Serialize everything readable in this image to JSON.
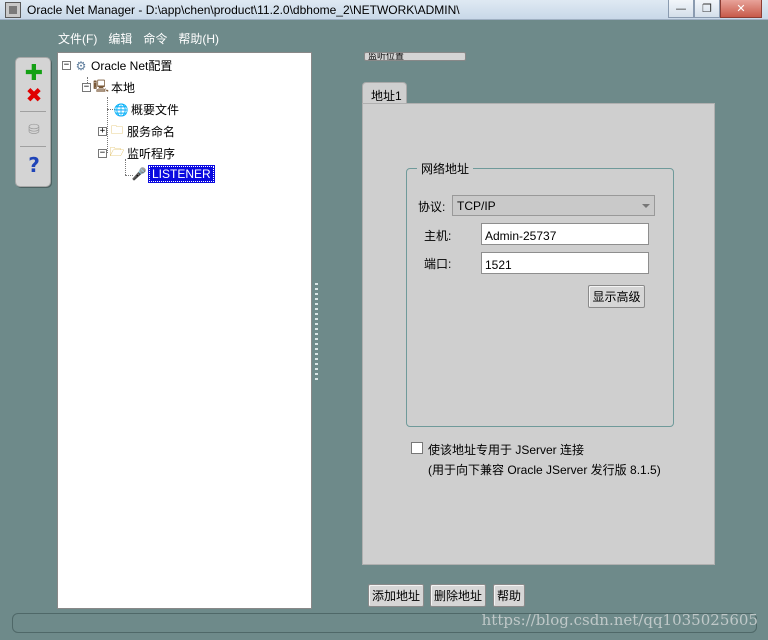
{
  "window": {
    "title": "Oracle Net Manager - D:\\app\\chen\\product\\11.2.0\\dbhome_2\\NETWORK\\ADMIN\\",
    "minimize_glyph": "—",
    "restore_glyph": "❐",
    "close_glyph": "✕"
  },
  "menu": [
    "文件(F)",
    "编辑",
    "命令",
    "帮助(H)"
  ],
  "toolbar": {
    "add_glyph": "✚",
    "remove_glyph": "✖",
    "db_glyph": "⛁",
    "help_glyph": "?"
  },
  "tree": {
    "root": "Oracle Net配置",
    "local": "本地",
    "profile": "概要文件",
    "service_naming": "服务命名",
    "listeners": "监听程序",
    "listener": "LISTENER"
  },
  "view_selector": "监听位置",
  "tabs": [
    "地址1"
  ],
  "network_address": {
    "group_title": "网络地址",
    "protocol_label": "协议:",
    "protocol_value": "TCP/IP",
    "host_label": "主机:",
    "host_value": "Admin-25737",
    "port_label": "端口:",
    "port_value": "1521",
    "advanced_button": "显示高级"
  },
  "jserver": {
    "checked": false,
    "label": "使该地址专用于 JServer 连接",
    "note": "(用于向下兼容 Oracle JServer 发行版 8.1.5)"
  },
  "buttons": {
    "add_address": "添加地址",
    "delete_address": "删除地址",
    "help": "帮助"
  },
  "watermark": "https://blog.csdn.net/qq1035025605",
  "colors": {
    "background": "#6e8a8a",
    "selection": "#0a0ae0",
    "panel": "#cfcfcf"
  }
}
